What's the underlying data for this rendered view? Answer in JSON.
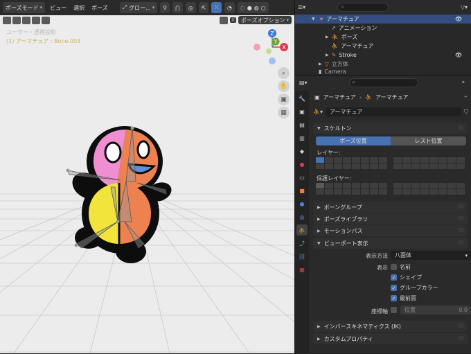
{
  "viewport": {
    "mode_label": "ポーズモード",
    "menus": [
      "ビュー",
      "選択",
      "ポーズ"
    ],
    "transform_orientation": "グロー...",
    "overlay_line1": "ユーザー・透視投影",
    "overlay_line2": "(1) アーマチュア : Bone.003",
    "pose_options_label": "ポーズオプション",
    "close_x": "X",
    "gizmo_axes": {
      "x": "X",
      "y": "Y",
      "z": "Z"
    },
    "colors": {
      "header": "#2a2a2a",
      "background": "#ececec",
      "selected_text": "#c7b85b"
    }
  },
  "outliner": {
    "items": [
      {
        "label": "アーマチュア",
        "selected": true
      },
      {
        "label": "アニメーション"
      },
      {
        "label": "ポーズ"
      },
      {
        "label": "アーマチュア"
      },
      {
        "label": "Stroke"
      },
      {
        "label": "立方体"
      },
      {
        "label": "Camera"
      }
    ]
  },
  "properties": {
    "breadcrumb_object": "アーマチュア",
    "breadcrumb_data": "アーマチュア",
    "data_name": "アーマチュア",
    "panels": {
      "skeleton": "スケルトン",
      "bone_groups": "ボーングループ",
      "pose_library": "ポーズライブラリ",
      "motion_paths": "モーションパス",
      "viewport_display": "ビューポート表示",
      "inverse_kinematics": "インバースキネマティクス (IK)",
      "custom_props": "カスタムプロパティ"
    },
    "pose_position": "ポーズ位置",
    "rest_position": "レスト位置",
    "layers_label": "レイヤー:",
    "protected_layers_label": "保護レイヤー:",
    "display_as_label": "表示方法",
    "display_as_value": "八面体",
    "show_label": "表示",
    "names_label": "名前",
    "shapes_label": "シェイプ",
    "group_colors_label": "グループカラー",
    "in_front_label": "最前面",
    "axes_label": "座標軸",
    "position_label": "位置",
    "position_value": "0.0",
    "accent_color": "#4772b3"
  }
}
